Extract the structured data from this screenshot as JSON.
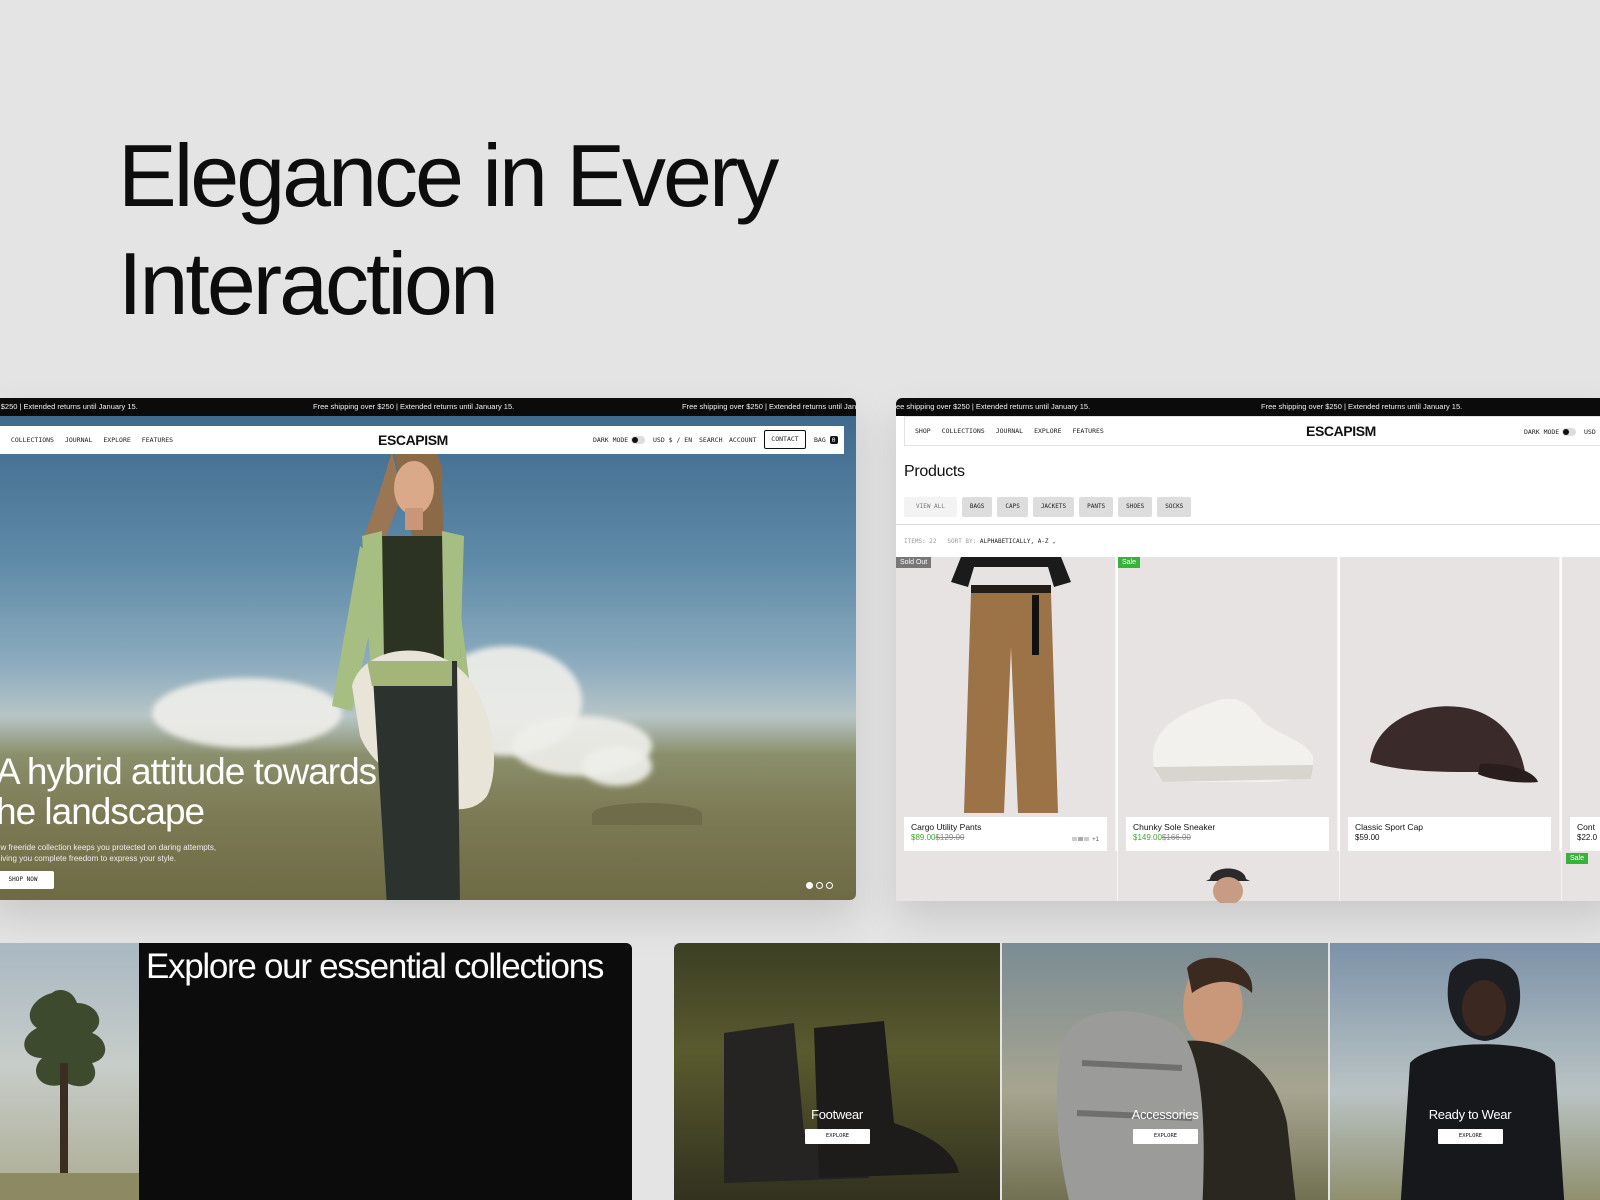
{
  "headline": {
    "line1": "Elegance in Every",
    "line2": "Interaction"
  },
  "hero_shot": {
    "promo_text_1": "er $250 | Extended returns until January 15.",
    "promo_text_2": "Free shipping over $250 | Extended returns until January 15.",
    "promo_text_3": "Free shipping over $250 | Extended returns until Jan",
    "nav": [
      "P",
      "COLLECTIONS",
      "JOURNAL",
      "EXPLORE",
      "FEATURES"
    ],
    "logo": "Escapism",
    "dark_mode": "DARK MODE",
    "currency": "USD $ / EN",
    "search": "SEARCH",
    "account": "ACCOUNT",
    "contact": "CONTACT",
    "bag": "BAG",
    "bag_count": "0",
    "title_line1": "A hybrid attitude towards",
    "title_line2": "he landscape",
    "subtitle_line1": "ew freeride collection keeps you protected on daring attempts,",
    "subtitle_line2": "giving you complete freedom to express your style.",
    "cta": "SHOP NOW"
  },
  "products_shot": {
    "promo_text_1": "ee shipping over $250 | Extended returns until January 15.",
    "promo_text_2": "Free shipping over $250 | Extended returns until January 15.",
    "nav": [
      "SHOP",
      "COLLECTIONS",
      "JOURNAL",
      "EXPLORE",
      "FEATURES"
    ],
    "logo": "Escapism",
    "dark_mode": "DARK MODE",
    "currency": "USD",
    "title": "Products",
    "filters": [
      "VIEW ALL",
      "BAGS",
      "CAPS",
      "JACKETS",
      "PANTS",
      "SHOES",
      "SOCKS"
    ],
    "items_label": "ITEMS: 22",
    "sort_label": "SORT BY:",
    "sort_value": "ALPHABETICALLY, A-Z",
    "products": [
      {
        "name": "Cargo Utility Pants",
        "price": "$89.00",
        "old_price": "$129.00",
        "badge": "Sold Out",
        "extra": "+1"
      },
      {
        "name": "Chunky Sole Sneaker",
        "price": "$149.00",
        "old_price": "$166.00",
        "badge": "Sale"
      },
      {
        "name": "Classic Sport Cap",
        "price": "$59.00"
      },
      {
        "name": "Cont",
        "price": "$22.0"
      }
    ],
    "row2_badge": "Sale"
  },
  "explore": {
    "title": "Explore our essential collections"
  },
  "collections": [
    {
      "label": "Footwear",
      "button": "EXPLORE"
    },
    {
      "label": "Accessories",
      "button": "EXPLORE"
    },
    {
      "label": "Ready to Wear",
      "button": "EXPLORE"
    }
  ]
}
